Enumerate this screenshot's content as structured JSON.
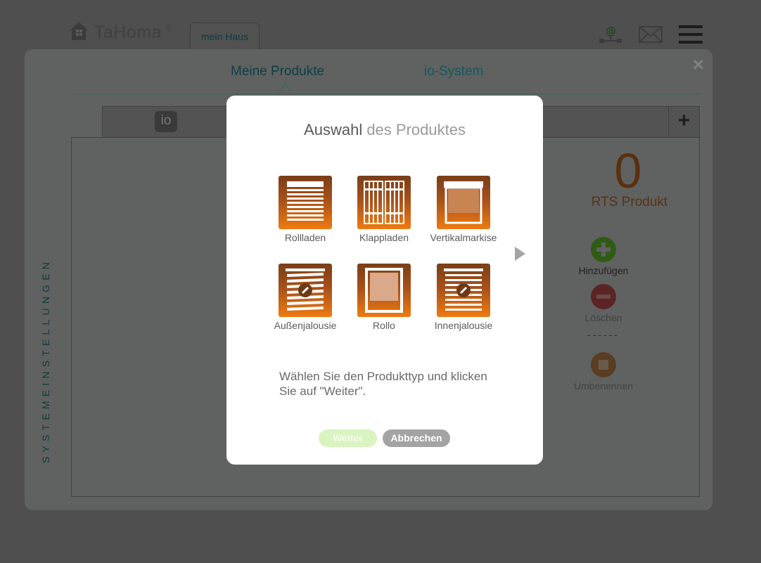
{
  "header": {
    "logo_text": "TaHoma",
    "logo_reg": "®",
    "location_tab": "mein Haus",
    "icons": [
      "house-logo-icon",
      "network-at-icon",
      "mail-icon",
      "menu-icon"
    ]
  },
  "panel": {
    "tabs": [
      {
        "label": "Meine Produkte",
        "active": true
      },
      {
        "label": "io-System",
        "active": false
      }
    ],
    "io_badge": "io",
    "add_icon": "+",
    "close_icon": "×",
    "vertical_label": "SYSTEMEINSTELLUNGEN",
    "count": "0",
    "count_label": "RTS Produkt",
    "actions": {
      "add": "Hinzufügen",
      "delete": "Löschen",
      "separator": "------",
      "rename": "Umbenennen"
    }
  },
  "modal": {
    "title_part1": "Auswahl",
    "title_part2": " des Produktes",
    "products": [
      {
        "label": "Rollladen",
        "icon": "roller-shutter-icon"
      },
      {
        "label": "Klappladen",
        "icon": "hinged-shutter-icon"
      },
      {
        "label": "Vertikalmarkise",
        "icon": "vertical-awning-icon"
      },
      {
        "label": "Außenjalousie",
        "icon": "exterior-blind-icon"
      },
      {
        "label": "Rollo",
        "icon": "roller-blind-icon"
      },
      {
        "label": "Innenjalousie",
        "icon": "interior-blind-icon"
      }
    ],
    "hint": "Wählen Sie den Produkttyp und klicken Sie auf \"Weiter\".",
    "next_label": "Weiter",
    "cancel_label": "Abbrechen"
  },
  "colors": {
    "accent_green": "#d9f4c0",
    "brand_orange": "#ef7a10",
    "cancel_gray": "#a3a3a3"
  }
}
